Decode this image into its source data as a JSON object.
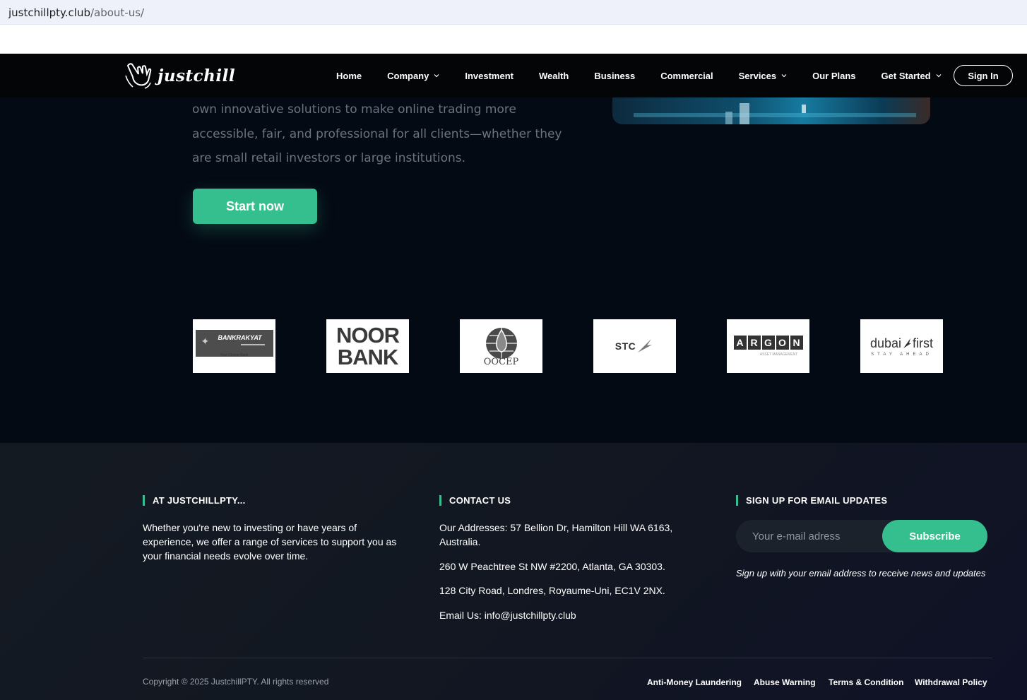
{
  "browser": {
    "url_host": "justchillpty.club",
    "url_path": "/about-us/"
  },
  "header": {
    "brand": "justchill",
    "nav": [
      {
        "label": "Home",
        "dropdown": false
      },
      {
        "label": "Company",
        "dropdown": true
      },
      {
        "label": "Investment",
        "dropdown": false
      },
      {
        "label": "Wealth",
        "dropdown": false
      },
      {
        "label": "Business",
        "dropdown": false
      },
      {
        "label": "Commercial",
        "dropdown": false
      },
      {
        "label": "Services",
        "dropdown": true
      },
      {
        "label": "Our Plans",
        "dropdown": false
      },
      {
        "label": "Get Started",
        "dropdown": true
      }
    ],
    "signin_label": "Sign In"
  },
  "hero": {
    "lines": [
      "own innovative solutions to make online trading more",
      "accessible, fair, and professional for all clients—whether they",
      "are small retail investors or large institutions."
    ],
    "cta_label": "Start now"
  },
  "partners": {
    "bankrakyat": {
      "name": "BANKRAKYAT",
      "tagline": "Your Choice Bank"
    },
    "noorbank": {
      "line1": "NOOR",
      "line2": "BANK"
    },
    "oocep": {
      "name": "OOCEP"
    },
    "stc": {
      "name": "STC"
    },
    "argon": {
      "letters": [
        "A",
        "R",
        "G",
        "O",
        "N"
      ],
      "sub": "ASSET MANAGEMENT"
    },
    "dubaifirst": {
      "left": "dubai",
      "right": "first",
      "tagline": "STAY AHEAD"
    }
  },
  "footer": {
    "about": {
      "title": "AT JUSTCHILLPTY...",
      "text": "Whether you're new to investing or have years of experience, we offer a range of services to support you as your financial needs evolve over time."
    },
    "contact": {
      "title": "CONTACT US",
      "address1": "Our Addresses: 57 Bellion Dr, Hamilton Hill WA 6163, Australia.",
      "address2": "260 W Peachtree St NW #2200, Atlanta, GA 30303.",
      "address3": "128 City Road, Londres, Royaume-Uni, EC1V 2NX.",
      "email": "Email Us: info@justchillpty.club"
    },
    "newsletter": {
      "title": "SIGN UP FOR EMAIL UPDATES",
      "placeholder": "Your e-mail adress",
      "button": "Subscribe",
      "note": "Sign up with your email address to receive news and updates"
    },
    "copyright": "Copyright © 2025 JustchillPTY. All rights reserved",
    "legal_links": [
      "Anti-Money Laundering",
      "Abuse Warning",
      "Terms & Condition",
      "Withdrawal Policy"
    ]
  },
  "colors": {
    "accent": "#35bf8f",
    "background": "#040a14",
    "header": "#040507"
  }
}
